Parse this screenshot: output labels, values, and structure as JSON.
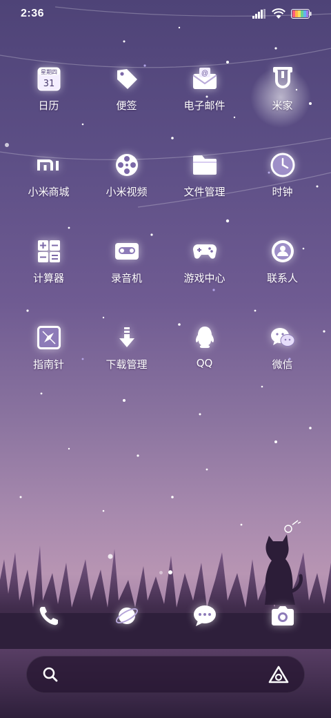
{
  "status_bar": {
    "time": "2:36",
    "icons": [
      "signal-icon",
      "wifi-icon",
      "battery-icon"
    ]
  },
  "apps": [
    {
      "label": "日历",
      "icon": "calendar-icon",
      "calendar_weekday": "星期四",
      "calendar_day": "31"
    },
    {
      "label": "便签",
      "icon": "notes-tag-icon"
    },
    {
      "label": "电子邮件",
      "icon": "email-icon"
    },
    {
      "label": "米家",
      "icon": "mijia-icon"
    },
    {
      "label": "小米商城",
      "icon": "mi-store-icon"
    },
    {
      "label": "小米视频",
      "icon": "film-reel-icon"
    },
    {
      "label": "文件管理",
      "icon": "folder-icon"
    },
    {
      "label": "时钟",
      "icon": "clock-icon"
    },
    {
      "label": "计算器",
      "icon": "calculator-icon"
    },
    {
      "label": "录音机",
      "icon": "cassette-icon"
    },
    {
      "label": "游戏中心",
      "icon": "gamepad-icon"
    },
    {
      "label": "联系人",
      "icon": "contact-icon"
    },
    {
      "label": "指南针",
      "icon": "compass-icon"
    },
    {
      "label": "下载管理",
      "icon": "download-icon"
    },
    {
      "label": "QQ",
      "icon": "qq-penguin-icon"
    },
    {
      "label": "微信",
      "icon": "wechat-icon"
    }
  ],
  "dock": [
    {
      "icon": "phone-icon"
    },
    {
      "icon": "browser-planet-icon"
    },
    {
      "icon": "message-icon"
    },
    {
      "icon": "camera-icon"
    }
  ],
  "page_indicator": {
    "pages": 2,
    "active": 2
  },
  "search": {
    "placeholder": "",
    "icon": "search-icon",
    "assistant_icon": "assistant-icon"
  },
  "colors": {
    "sky_top": "#4e4377",
    "sky_mid": "#8a739f",
    "horizon": "#b895b3",
    "ground": "#2e1f3b",
    "search_bg": "#261630"
  }
}
